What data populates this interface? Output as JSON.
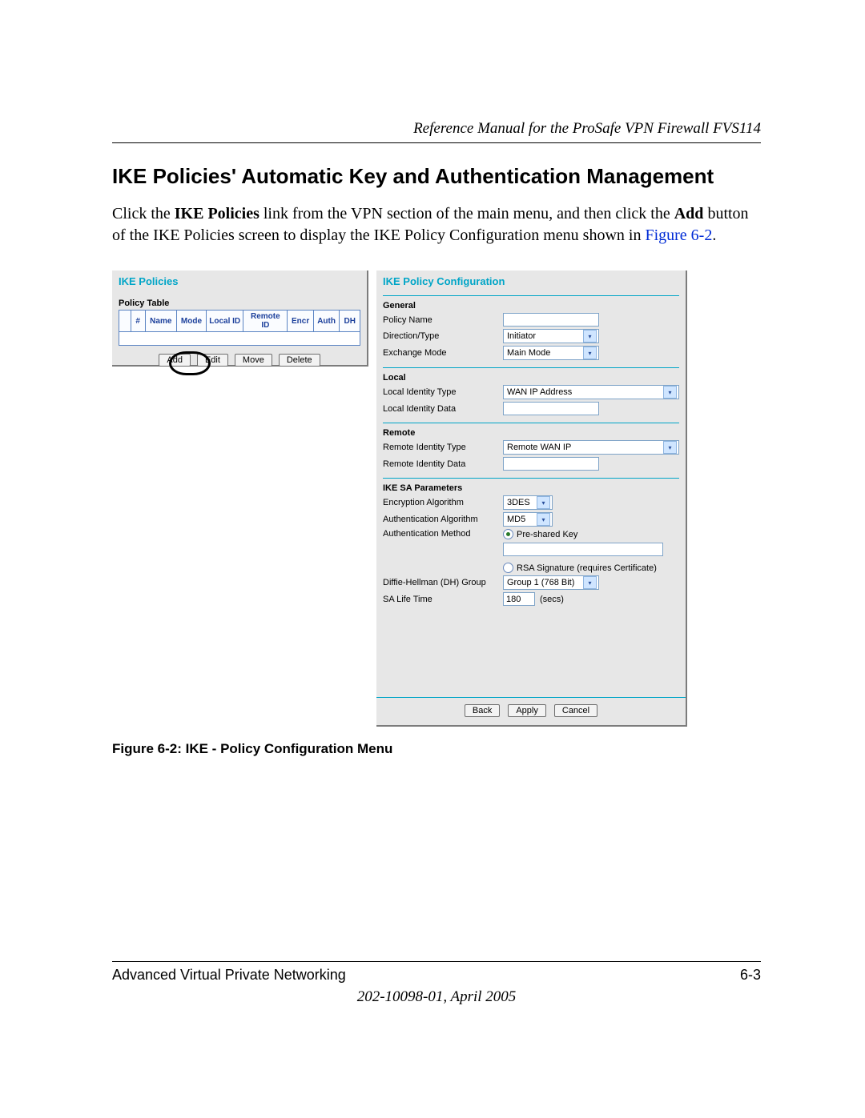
{
  "header": {
    "running_head": "Reference Manual for the ProSafe VPN Firewall FVS114"
  },
  "section_title": "IKE Policies' Automatic Key and Authentication Management",
  "body": {
    "pre1": "Click the ",
    "b1": "IKE Policies",
    "mid1": " link from the VPN section of the main menu, and then click the ",
    "b2": "Add",
    "mid2": " button of the IKE Policies screen to display the IKE Policy Configuration menu shown in ",
    "figref": "Figure 6-2",
    "tail": "."
  },
  "ike_policies": {
    "title": "IKE Policies",
    "table_label": "Policy Table",
    "columns": [
      "",
      "#",
      "Name",
      "Mode",
      "Local ID",
      "Remote ID",
      "Encr",
      "Auth",
      "DH"
    ],
    "buttons": {
      "add": "Add",
      "edit": "Edit",
      "move": "Move",
      "delete": "Delete"
    }
  },
  "ike_config": {
    "title": "IKE Policy Configuration",
    "general": {
      "heading": "General",
      "policy_name": {
        "label": "Policy Name",
        "value": ""
      },
      "direction": {
        "label": "Direction/Type",
        "value": "Initiator"
      },
      "exchange": {
        "label": "Exchange Mode",
        "value": "Main Mode"
      }
    },
    "local": {
      "heading": "Local",
      "id_type": {
        "label": "Local Identity Type",
        "value": "WAN IP Address"
      },
      "id_data": {
        "label": "Local Identity Data",
        "value": ""
      }
    },
    "remote": {
      "heading": "Remote",
      "id_type": {
        "label": "Remote Identity Type",
        "value": "Remote WAN IP"
      },
      "id_data": {
        "label": "Remote Identity Data",
        "value": ""
      }
    },
    "sa": {
      "heading": "IKE SA Parameters",
      "enc": {
        "label": "Encryption Algorithm",
        "value": "3DES"
      },
      "auth": {
        "label": "Authentication Algorithm",
        "value": "MD5"
      },
      "method_label": "Authentication Method",
      "method_psk": "Pre-shared Key",
      "method_rsa": "RSA Signature (requires Certificate)",
      "dh": {
        "label": "Diffie-Hellman (DH) Group",
        "value": "Group 1 (768 Bit)"
      },
      "life": {
        "label": "SA Life Time",
        "value": "180",
        "unit": "(secs)"
      }
    },
    "buttons": {
      "back": "Back",
      "apply": "Apply",
      "cancel": "Cancel"
    }
  },
  "figure_caption": "Figure 6-2: IKE - Policy Configuration Menu",
  "footer": {
    "chapter": "Advanced Virtual Private Networking",
    "page": "6-3",
    "docrev": "202-10098-01, April 2005"
  }
}
